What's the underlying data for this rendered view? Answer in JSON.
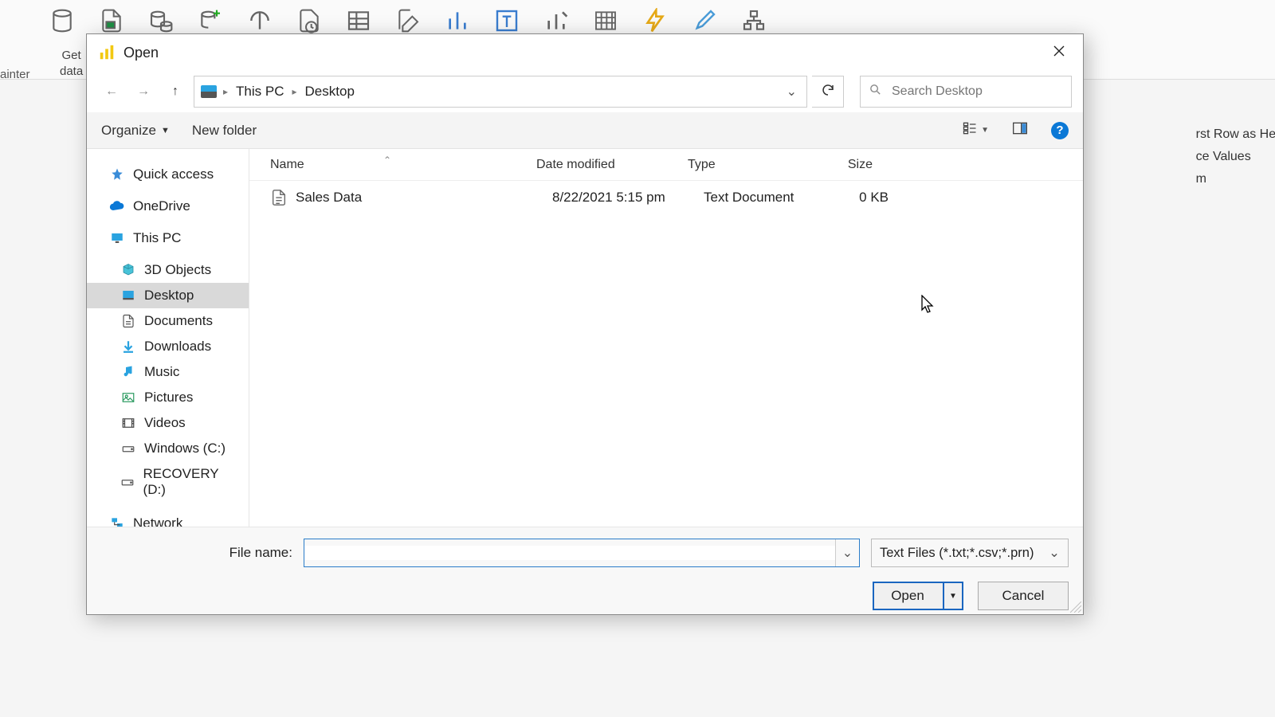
{
  "ribbon": {
    "painter": "ainter",
    "get_data": "Get\ndata"
  },
  "dialog": {
    "title": "Open",
    "breadcrumb": [
      "This PC",
      "Desktop"
    ],
    "search_placeholder": "Search Desktop",
    "organize": "Organize",
    "new_folder": "New folder",
    "columns": {
      "name": "Name",
      "date": "Date modified",
      "type": "Type",
      "size": "Size"
    },
    "sidebar": {
      "quick_access": "Quick access",
      "onedrive": "OneDrive",
      "this_pc": "This PC",
      "objects3d": "3D Objects",
      "desktop": "Desktop",
      "documents": "Documents",
      "downloads": "Downloads",
      "music": "Music",
      "pictures": "Pictures",
      "videos": "Videos",
      "windows_c": "Windows (C:)",
      "recovery_d": "RECOVERY (D:)",
      "network": "Network"
    },
    "files": [
      {
        "name": "Sales Data",
        "date": "8/22/2021 5:15 pm",
        "type": "Text Document",
        "size": "0 KB"
      }
    ],
    "file_name_label": "File name:",
    "file_name_value": "",
    "filter": "Text Files (*.txt;*.csv;*.prn)",
    "open_btn": "Open",
    "cancel_btn": "Cancel",
    "help": "?"
  },
  "right_panel": {
    "line1": "rst Row as Hea",
    "line2": "ce Values",
    "line3": "m"
  }
}
